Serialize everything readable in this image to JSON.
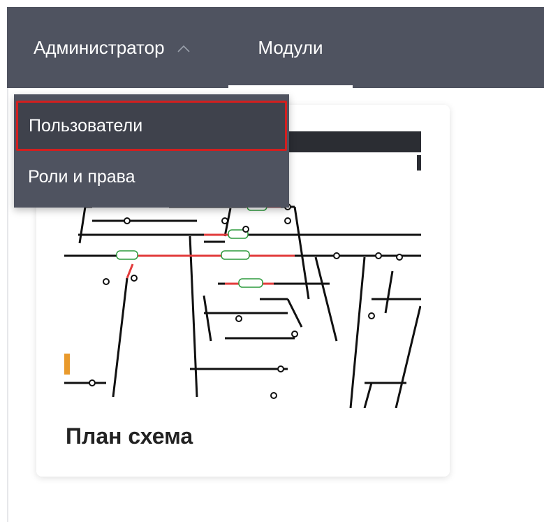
{
  "header": {
    "admin_label": "Администратор",
    "admin_icon": "chevron-up-icon",
    "modules_label": "Модули"
  },
  "dropdown": {
    "items": [
      {
        "label": "Пользователи",
        "highlighted": true
      },
      {
        "label": "Роли и права"
      }
    ]
  },
  "card": {
    "title": "План схема",
    "image": "track-layout-schematic"
  },
  "colors": {
    "header_bg": "#4f5360",
    "dropdown_bg": "#4f5360",
    "highlight_border": "#d31f1f",
    "text_light": "#ffffff",
    "card_title": "#222222"
  }
}
